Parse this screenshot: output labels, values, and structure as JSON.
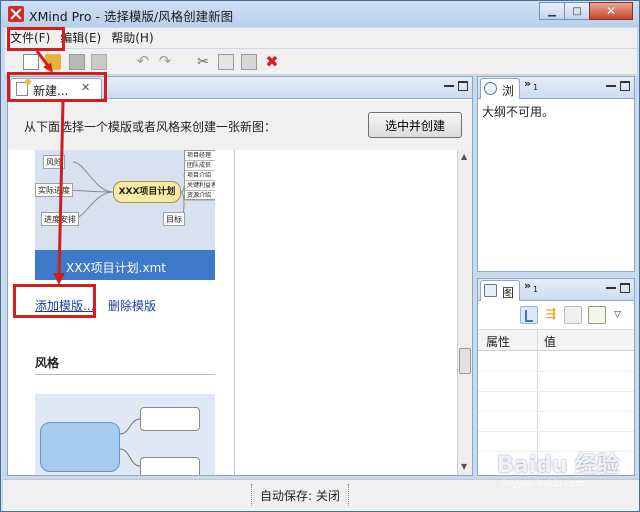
{
  "window": {
    "title": "XMind Pro - 选择模版/风格创建新图"
  },
  "menu": {
    "file": "文件(F)",
    "edit": "编辑(E)",
    "help": "帮助(H)"
  },
  "editor": {
    "tab_label": "新建...",
    "instructions": "从下面选择一个模版或者风格来创建一张新图：",
    "create_button": "选中并创建",
    "template_caption": "XXX项目计划.xmt",
    "central_topic": "XXX项目计划",
    "topics": [
      "风险",
      "实际进度",
      "进度安排",
      "目标"
    ],
    "grid_rows": [
      "项目经理",
      "团队成员",
      "项目介绍",
      "关键利益者",
      "资源介绍"
    ],
    "add_template": "添加模版...",
    "delete_template": "删除模版",
    "style_section": "风格"
  },
  "outline": {
    "tab_label": "浏",
    "overflow_count": "1",
    "message": "大纲不可用。"
  },
  "properties": {
    "tab_label": "图",
    "overflow_count": "1",
    "col_property": "属性",
    "col_value": "值"
  },
  "status": {
    "autosave": "自动保存: 关闭"
  },
  "watermark": {
    "text": "Baidu 经验",
    "sub": "jingyan.baidu.com"
  },
  "colors": {
    "annotation": "#d11e1e",
    "caption_bar": "#3f79c9",
    "link": "#1a3fa3"
  }
}
